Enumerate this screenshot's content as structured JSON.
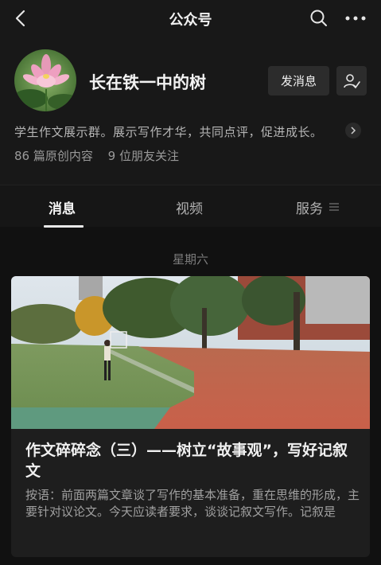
{
  "top_bar": {
    "title": "公众号",
    "back_icon": "chevron-left-icon",
    "search_icon": "search-icon",
    "more_icon": "more-dots-icon"
  },
  "profile": {
    "name": "长在铁一中的树",
    "avatar_icon": "lotus-flower-avatar",
    "message_button": "发消息",
    "follow_icon": "followed-user-icon",
    "description": "学生作文展示群。展示写作才华，共同点评，促进成长。",
    "original_count": "86 篇原创内容",
    "friends_following": "9 位朋友关注"
  },
  "tabs": {
    "messages": "消息",
    "videos": "视频",
    "services": "服务",
    "active": "消息"
  },
  "feed": {
    "date_label": "星期六",
    "articles": [
      {
        "title": "作文碎碎念（三）——树立“故事观”，写好记叙文",
        "summary": "按语：前面两篇文章谈了写作的基本准备，重在思维的形成，主要针对议论文。今天应读者要求，谈谈记叙文写作。记叙是",
        "image": "running-track-photo"
      }
    ]
  },
  "colors": {
    "background": "#111111",
    "header": "#181818",
    "card": "#1e1e1e",
    "button": "#2c2c2c"
  }
}
